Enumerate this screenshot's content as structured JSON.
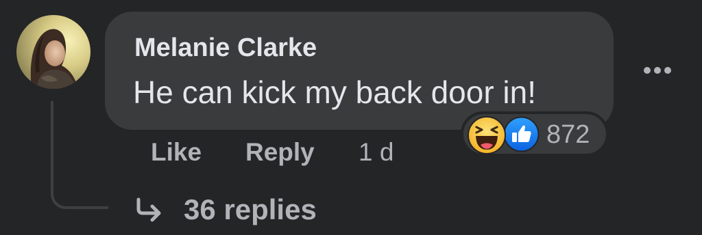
{
  "comment": {
    "author": "Melanie Clarke",
    "text": "He can kick my back door in!",
    "timestamp": "1 d",
    "avatar_icon": "profile-photo"
  },
  "reactions": {
    "icons": [
      "haha-icon",
      "like-icon"
    ],
    "count": "872"
  },
  "actions": {
    "like_label": "Like",
    "reply_label": "Reply"
  },
  "replies": {
    "label": "36 replies",
    "icon": "reply-arrow-icon"
  },
  "menu": {
    "icon": "more-options-icon"
  },
  "colors": {
    "background": "#242526",
    "bubble": "#3a3b3c",
    "text_primary": "#e4e6eb",
    "text_secondary": "#b0b3b8",
    "like_blue": "#1877f2",
    "haha_yellow": "#f7b928"
  }
}
